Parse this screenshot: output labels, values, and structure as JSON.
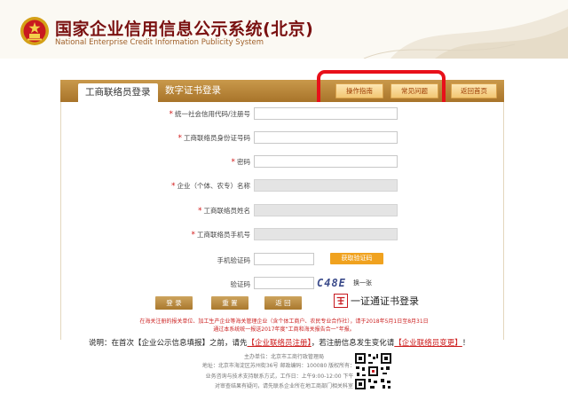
{
  "header": {
    "title_cn": "国家企业信用信息公示系统(北京)",
    "title_en": "National Enterprise Credit Information Publicity System"
  },
  "tabs": {
    "active": "工商联络员登录",
    "other": "数字证书登录"
  },
  "top_buttons": {
    "guide": "操作指南",
    "faq": "常见问题",
    "home": "返回首页"
  },
  "form": {
    "fields": [
      {
        "label": "统一社会信用代码/注册号",
        "required": true
      },
      {
        "label": "工商联络员身份证号码",
        "required": true
      },
      {
        "label": "密码",
        "required": true
      },
      {
        "label": "企业（个体、农专）名称",
        "required": true
      },
      {
        "label": "工商联络员姓名",
        "required": true
      },
      {
        "label": "工商联络员手机号",
        "required": true
      }
    ],
    "sms_label": "手机验证码",
    "sms_button": "获取验证码",
    "captcha_label": "验证码",
    "captcha_value": "C48E",
    "refresh": "换一张",
    "login": "登 录",
    "reset": "重 置",
    "back": "返 回",
    "cert_login": "一证通证书登录"
  },
  "notice": {
    "line1": "在海关注册的报关单位、加工生产企业等海关管理企业（含个体工商户、农民专业合作社），请于2018年5月1日至8月31日",
    "line2": "通过本系统统一报送2017年度“工商和海关报告合一”年报。"
  },
  "explain": {
    "prefix": "说明：在首次【企业公示信息填报】之前，请先",
    "link1": "【企业联络员注册】",
    "middle": "，若注册信息发生变化请",
    "link2": "【企业联络员变更】",
    "suffix": "！"
  },
  "footer": {
    "line1": "主办单位：北京市工商行政管理局",
    "line2": "地址：北京市海淀区苏州街36号   邮政编码：100080   版权所有：北京",
    "line3": "业务咨询与技术支持联系方式，工作日：上午9:00-12:00 下午：1",
    "line4": "对审查结果有疑问，请先联系企业所在地工商部门相关科室"
  },
  "colors": {
    "brand_brown": "#a8742a",
    "highlight_red": "#e8101a",
    "title_red": "#7a1111"
  }
}
